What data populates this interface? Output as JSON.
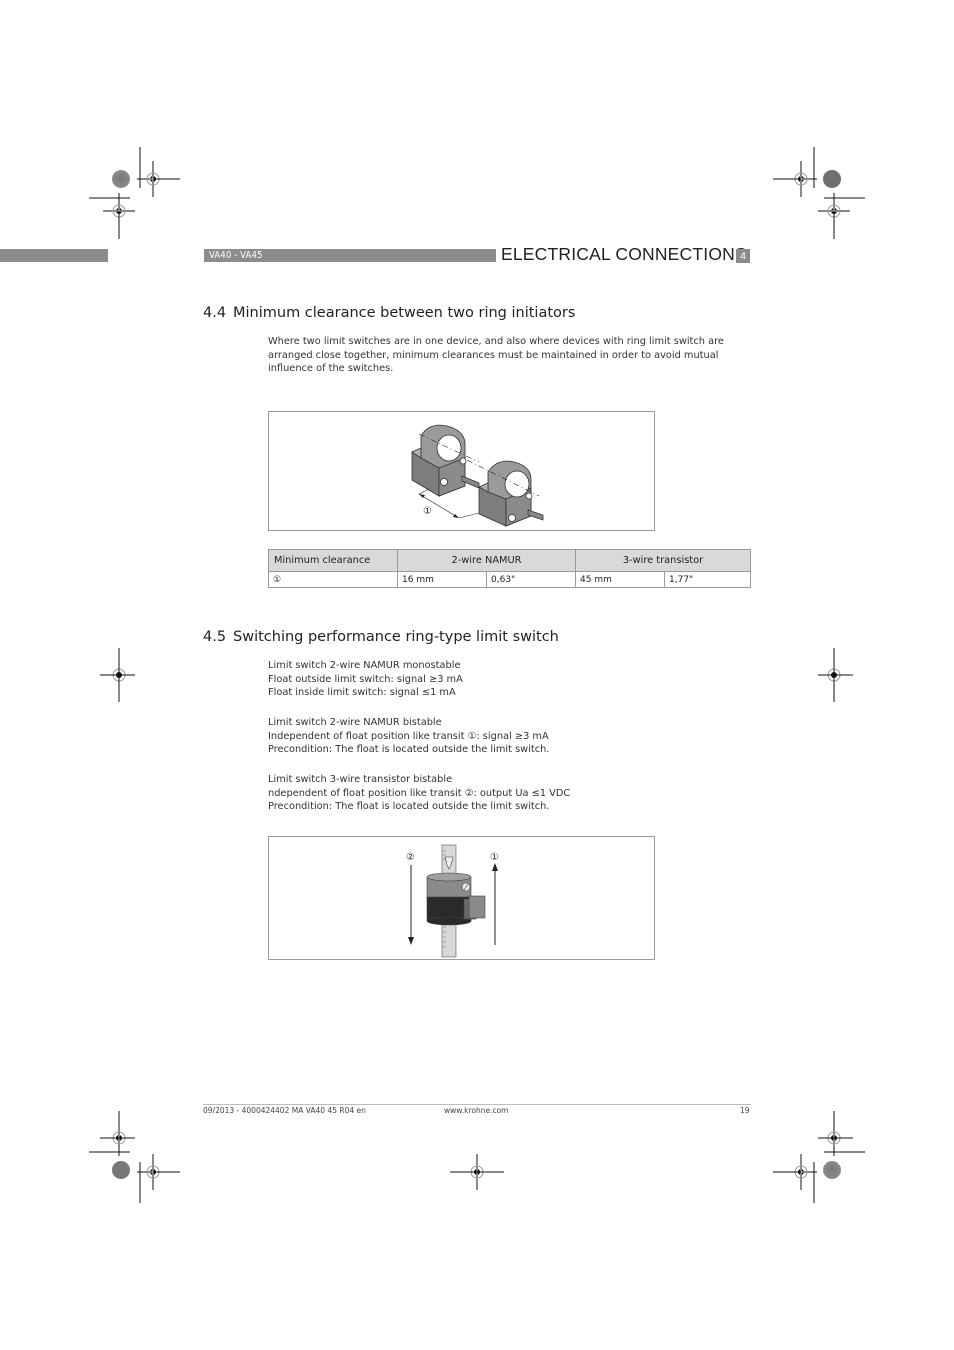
{
  "header": {
    "model_label": "VA40 - VA45",
    "chapter_title": "ELECTRICAL CONNECTIONS",
    "chapter_number": "4",
    "band_color": "#8c8c8c"
  },
  "section_4_4": {
    "number": "4.4",
    "title": "Minimum clearance between two ring initiators",
    "intro_lines": [
      "Where two limit switches are in one device, and also where devices with ring limit switch are",
      "arranged close together, minimum clearances must be maintained in order to avoid mutual",
      "influence of the switches."
    ],
    "figure": {
      "callout": "①"
    },
    "table": {
      "headers": [
        "Minimum clearance",
        "2-wire NAMUR",
        "3-wire transistor"
      ],
      "rows": [
        [
          "①",
          "16 mm",
          "0,63\"",
          "45 mm",
          "1,77\""
        ]
      ]
    }
  },
  "section_4_5": {
    "number": "4.5",
    "title": "Switching performance ring-type limit switch",
    "blocks": [
      [
        "Limit switch 2-wire NAMUR monostable",
        "Float outside limit switch: signal ≥3 mA",
        "Float inside limit switch: signal ≤1 mA"
      ],
      [
        "Limit switch 2-wire NAMUR bistable",
        "Independent of float position like transit ①: signal ≥3 mA",
        "Precondition: The float is located outside the limit switch."
      ],
      [
        "Limit switch 3-wire transistor bistable",
        "ndependent of float position like transit ②: output Ua ≤1 VDC",
        "Precondition: The float is located outside the limit switch."
      ]
    ],
    "figure": {
      "callout_down": "②",
      "callout_up": "①"
    }
  },
  "footer": {
    "doc_ref": "09/2013 - 4000424402  MA VA40 45 R04 en",
    "website": "www.krohne.com",
    "page_number": "19"
  }
}
